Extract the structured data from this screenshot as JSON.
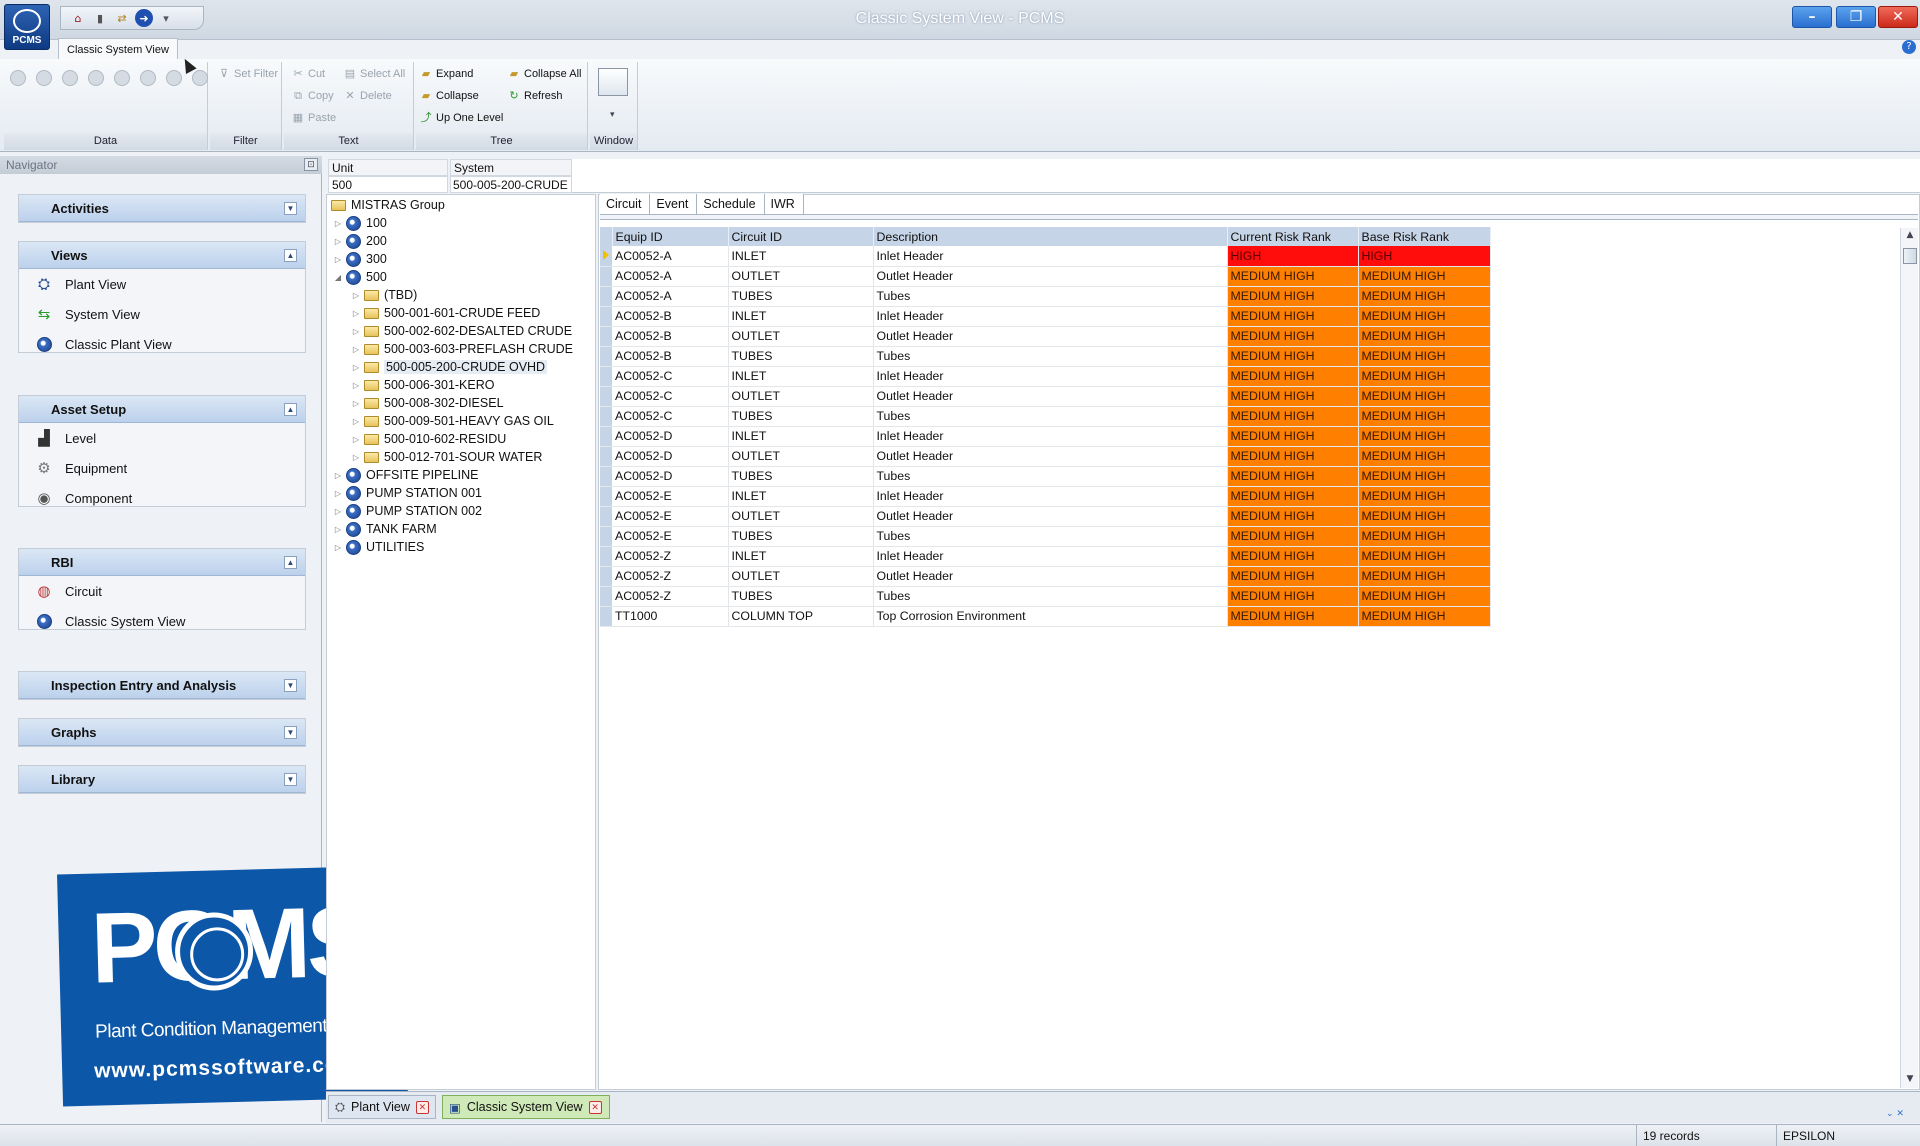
{
  "window": {
    "title": "Classic System View - PCMS",
    "logo_text": "PCMS"
  },
  "ribbon": {
    "tab_label": "Classic System View",
    "groups": {
      "data": "Data",
      "filter": "Filter",
      "text": "Text",
      "tree": "Tree",
      "window": "Window"
    },
    "buttons": {
      "set_filter": "Set Filter",
      "cut": "Cut",
      "select_all": "Select All",
      "copy": "Copy",
      "delete": "Delete",
      "paste": "Paste",
      "expand": "Expand",
      "collapse_all": "Collapse All",
      "collapse": "Collapse",
      "refresh": "Refresh",
      "up_one_level": "Up One Level"
    }
  },
  "navigator": {
    "title": "Navigator",
    "sections": {
      "activities": "Activities",
      "views": "Views",
      "asset_setup": "Asset Setup",
      "rbi": "RBI",
      "inspection": "Inspection Entry and Analysis",
      "graphs": "Graphs",
      "library": "Library"
    },
    "views_items": [
      "Plant View",
      "System View",
      "Classic Plant View"
    ],
    "asset_items": [
      "Level",
      "Equipment",
      "Component"
    ],
    "rbi_items": [
      "Circuit",
      "Classic System View"
    ]
  },
  "logo": {
    "name": "PCMS",
    "subtitle": "Plant Condition Management Software",
    "url": "www.pcmssoftware.com"
  },
  "filter": {
    "unit_label": "Unit",
    "system_label": "System",
    "unit_value": "500",
    "system_value": "500-005-200-CRUDE"
  },
  "tree": {
    "root": "MISTRAS Group",
    "units_top": [
      "100",
      "200",
      "300",
      "500"
    ],
    "systems": [
      "(TBD)",
      "500-001-601-CRUDE FEED",
      "500-002-602-DESALTED CRUDE",
      "500-003-603-PREFLASH CRUDE",
      "500-005-200-CRUDE OVHD",
      "500-006-301-KERO",
      "500-008-302-DIESEL",
      "500-009-501-HEAVY GAS OIL",
      "500-010-602-RESIDU",
      "500-012-701-SOUR WATER"
    ],
    "units_bottom": [
      "OFFSITE PIPELINE",
      "PUMP STATION 001",
      "PUMP STATION 002",
      "TANK FARM",
      "UTILITIES"
    ]
  },
  "grid": {
    "tabs": [
      "Circuit",
      "Event",
      "Schedule",
      "IWR"
    ],
    "columns": [
      "Equip ID",
      "Circuit ID",
      "Description",
      "Current Risk Rank",
      "Base Risk Rank"
    ],
    "rows": [
      [
        "AC0052-A",
        "INLET",
        "Inlet Header",
        "HIGH",
        "HIGH"
      ],
      [
        "AC0052-A",
        "OUTLET",
        "Outlet Header",
        "MEDIUM HIGH",
        "MEDIUM HIGH"
      ],
      [
        "AC0052-A",
        "TUBES",
        "Tubes",
        "MEDIUM HIGH",
        "MEDIUM HIGH"
      ],
      [
        "AC0052-B",
        "INLET",
        "Inlet Header",
        "MEDIUM HIGH",
        "MEDIUM HIGH"
      ],
      [
        "AC0052-B",
        "OUTLET",
        "Outlet Header",
        "MEDIUM HIGH",
        "MEDIUM HIGH"
      ],
      [
        "AC0052-B",
        "TUBES",
        "Tubes",
        "MEDIUM HIGH",
        "MEDIUM HIGH"
      ],
      [
        "AC0052-C",
        "INLET",
        "Inlet Header",
        "MEDIUM HIGH",
        "MEDIUM HIGH"
      ],
      [
        "AC0052-C",
        "OUTLET",
        "Outlet Header",
        "MEDIUM HIGH",
        "MEDIUM HIGH"
      ],
      [
        "AC0052-C",
        "TUBES",
        "Tubes",
        "MEDIUM HIGH",
        "MEDIUM HIGH"
      ],
      [
        "AC0052-D",
        "INLET",
        "Inlet Header",
        "MEDIUM HIGH",
        "MEDIUM HIGH"
      ],
      [
        "AC0052-D",
        "OUTLET",
        "Outlet Header",
        "MEDIUM HIGH",
        "MEDIUM HIGH"
      ],
      [
        "AC0052-D",
        "TUBES",
        "Tubes",
        "MEDIUM HIGH",
        "MEDIUM HIGH"
      ],
      [
        "AC0052-E",
        "INLET",
        "Inlet Header",
        "MEDIUM HIGH",
        "MEDIUM HIGH"
      ],
      [
        "AC0052-E",
        "OUTLET",
        "Outlet Header",
        "MEDIUM HIGH",
        "MEDIUM HIGH"
      ],
      [
        "AC0052-E",
        "TUBES",
        "Tubes",
        "MEDIUM HIGH",
        "MEDIUM HIGH"
      ],
      [
        "AC0052-Z",
        "INLET",
        "Inlet Header",
        "MEDIUM HIGH",
        "MEDIUM HIGH"
      ],
      [
        "AC0052-Z",
        "OUTLET",
        "Outlet Header",
        "MEDIUM HIGH",
        "MEDIUM HIGH"
      ],
      [
        "AC0052-Z",
        "TUBES",
        "Tubes",
        "MEDIUM HIGH",
        "MEDIUM HIGH"
      ],
      [
        "TT1000",
        "COLUMN TOP",
        "Top Corrosion Environment",
        "MEDIUM HIGH",
        "MEDIUM HIGH"
      ]
    ],
    "risk_colors": {
      "HIGH": "#ff0c0c",
      "MEDIUM HIGH": "#ff7f00"
    }
  },
  "doc_tabs": [
    "Plant View",
    "Classic System View"
  ],
  "status": {
    "records": "19 records",
    "database": "EPSILON"
  }
}
